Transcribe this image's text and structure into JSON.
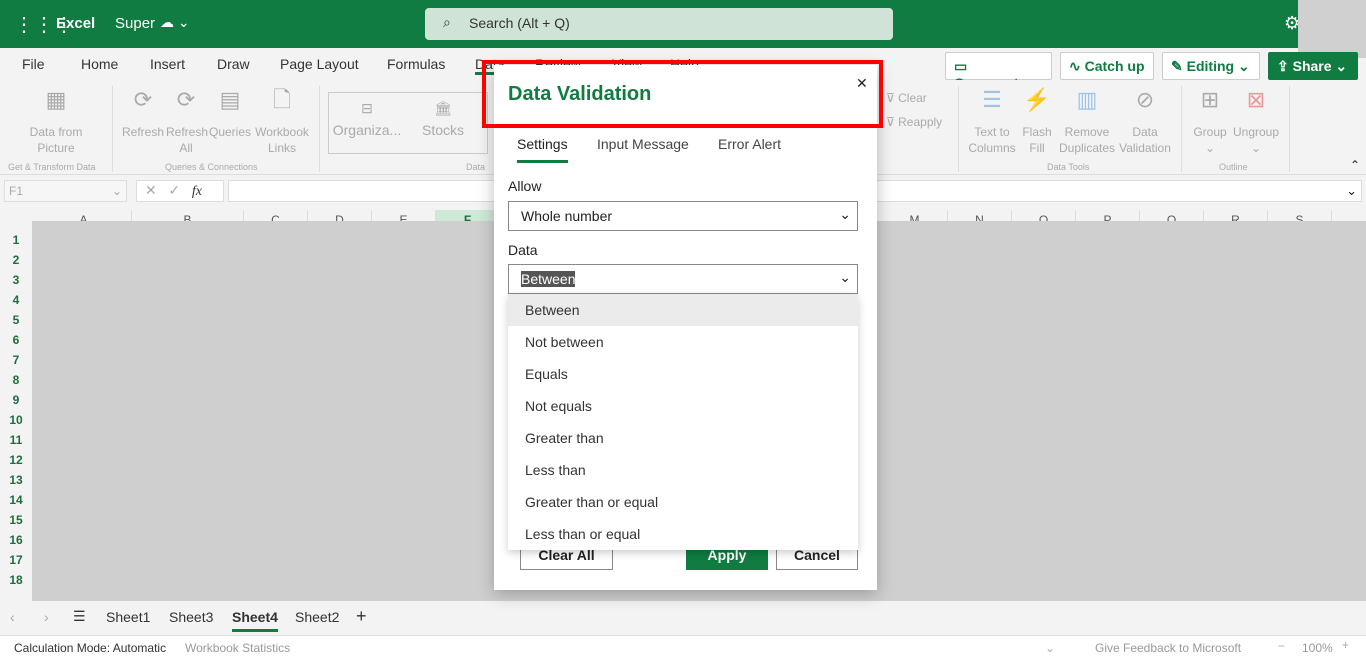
{
  "app": {
    "name": "Excel",
    "file": "Super",
    "search_placeholder": "Search (Alt + Q)"
  },
  "ribbon_tabs": [
    "File",
    "Home",
    "Insert",
    "Draw",
    "Page Layout",
    "Formulas",
    "Data",
    "Review",
    "View",
    "Help"
  ],
  "header_buttons": {
    "comments": "Comments",
    "catch_up": "Catch up",
    "editing": "Editing",
    "share": "Share"
  },
  "ribbon": {
    "data_from_picture": "Data from Picture",
    "refresh": "Refresh",
    "refresh_all": "Refresh All",
    "queries": "Queries",
    "workbook_links": "Workbook Links",
    "organization": "Organiza...",
    "stocks": "Stocks",
    "clear": "Clear",
    "reapply": "Reapply",
    "text_to_columns": "Text to Columns",
    "flash_fill": "Flash Fill",
    "remove_duplicates": "Remove Duplicates",
    "data_validation": "Data Validation",
    "group": "Group",
    "ungroup": "Ungroup",
    "groups": {
      "get_transform": "Get & Transform Data",
      "queries_connections": "Queries & Connections",
      "data_types": "Data",
      "data_tools": "Data Tools",
      "outline": "Outline"
    }
  },
  "formula_bar": {
    "name_box": "F1",
    "fx": "fx",
    "value": ""
  },
  "columns": [
    "A",
    "B",
    "C",
    "D",
    "E",
    "F",
    "M",
    "N",
    "O",
    "P",
    "Q",
    "R",
    "S"
  ],
  "rows": [
    "1",
    "2",
    "3",
    "4",
    "5",
    "6",
    "7",
    "8",
    "9",
    "10",
    "11",
    "12",
    "13",
    "14",
    "15",
    "16",
    "17",
    "18"
  ],
  "dialog": {
    "title": "Data Validation",
    "tabs": [
      "Settings",
      "Input Message",
      "Error Alert"
    ],
    "active_tab": "Settings",
    "allow_label": "Allow",
    "allow_value": "Whole number",
    "data_label": "Data",
    "data_value": "Between",
    "options": [
      "Between",
      "Not between",
      "Equals",
      "Not equals",
      "Greater than",
      "Less than",
      "Greater than or equal",
      "Less than or equal"
    ],
    "clear_all": "Clear All",
    "apply": "Apply",
    "cancel": "Cancel"
  },
  "sheets": [
    "Sheet1",
    "Sheet3",
    "Sheet4",
    "Sheet2"
  ],
  "active_sheet": "Sheet4",
  "status": {
    "calc_mode": "Calculation Mode: Automatic",
    "stats": "Workbook Statistics",
    "feedback": "Give Feedback to Microsoft",
    "zoom": "100%"
  },
  "colors": {
    "brand": "#107c41",
    "highlight": "#ff0000"
  }
}
